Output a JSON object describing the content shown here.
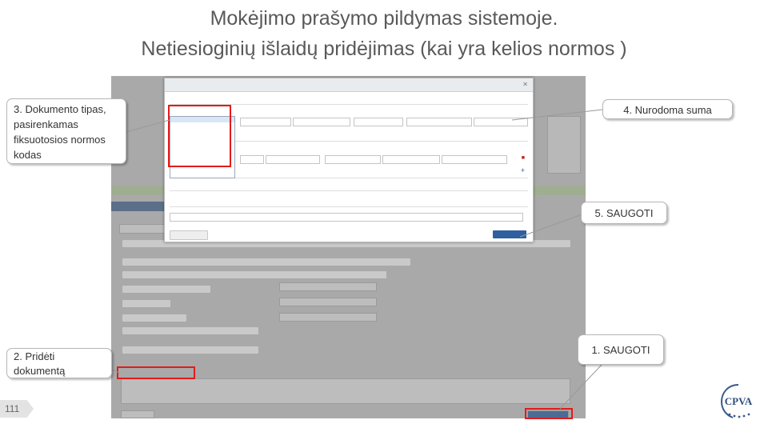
{
  "slide": {
    "title_line1": "Mokėjimo prašymo  pildymas sistemoje.",
    "title_line2": "Netiesioginių išlaidų pridėjimas (kai yra kelios normos )",
    "page_number": "111",
    "logo_text": "CPVA"
  },
  "callouts": {
    "step3": "3. Dokumento tipas, pasirenkamas fiksuotosios normos kodas",
    "step4": "4. Nurodoma suma",
    "step5": "5. SAUGOTI",
    "step2": "2. Pridėti dokumentą",
    "step1": "1. SAUGOTI"
  },
  "colors": {
    "highlight": "#e31b1b",
    "primary_button": "#2f5f9e",
    "title_text": "#595959"
  }
}
